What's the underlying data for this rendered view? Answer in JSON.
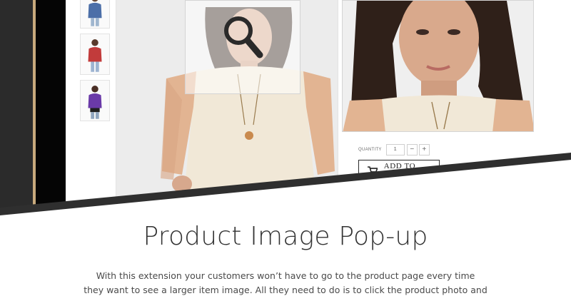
{
  "shop": {
    "quantity": {
      "label": "QUANTITY",
      "value": "1",
      "decrement": "−",
      "increment": "+"
    },
    "add_to_cart": {
      "label": "ADD TO CART",
      "icon": "cart-icon"
    },
    "zoom_icon": "magnifier-icon",
    "thumbnails": [
      {
        "name": "thumbnail-blue-top",
        "color": "#4c6fa8"
      },
      {
        "name": "thumbnail-red-top",
        "color": "#c23b3b"
      },
      {
        "name": "thumbnail-purple-top",
        "color": "#6a3aa8"
      }
    ],
    "blouse_color": "#f1e8d7",
    "lace_color": "#e2b492"
  },
  "feature": {
    "title": "Product Image Pop-up",
    "description_lines": [
      "With this extension your customers won’t have to go to the product page every time",
      "they want to see a larger item image. All they need to do is to click the product photo and"
    ]
  },
  "colors": {
    "frame_dark": "#2b2b2b",
    "frame_gold": "#c8aa7d",
    "divider": "#2f2f2f",
    "title_text": "#333333",
    "body_text": "#4a4a4a"
  }
}
